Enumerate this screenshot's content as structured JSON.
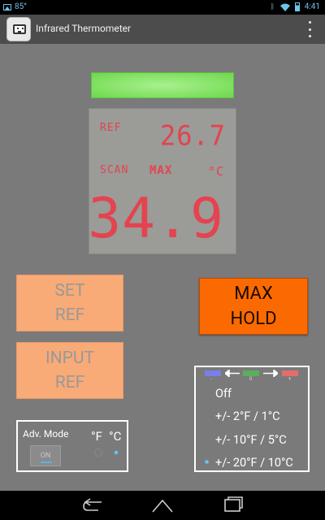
{
  "statusbar": {
    "notification_text": "85°",
    "time": "4:41"
  },
  "actionbar": {
    "title": "Infrared Thermometer",
    "icons": [
      "app-icon",
      "overflow-menu-icon"
    ]
  },
  "colors": {
    "indicator": "#7fe060",
    "lcd_background": "#9b9b98",
    "lcd_digits": "#f06060",
    "set_button": "#f8aa77",
    "max_button": "#fb6a00",
    "accent": "#5ab4e0"
  },
  "display": {
    "ref_label": "REF",
    "ref_value": "26.7",
    "scan_label": "SCAN",
    "mode_label": "MAX",
    "unit_label": "°C",
    "reading": "34.9"
  },
  "buttons": {
    "set_ref": "SET\nREF",
    "input_ref": "INPUT\nREF",
    "max_hold": "MAX\nHOLD"
  },
  "adv_mode": {
    "label": "Adv. Mode",
    "toggle": "ON",
    "unit_f": "°F",
    "unit_c": "°C",
    "selected_unit": "°C"
  },
  "tolerance": {
    "legend": [
      {
        "symbol": "-",
        "color": "#7a7ee8"
      },
      {
        "symbol": "0",
        "color": "#58b058"
      },
      {
        "symbol": "+",
        "color": "#e46c6c"
      }
    ],
    "options": [
      "Off",
      "+/- 2°F / 1°C",
      "+/- 10°F / 5°C",
      "+/- 20°F / 10°C"
    ],
    "selected": "+/- 20°F / 10°C"
  },
  "navbar": {
    "icons": [
      "back-icon",
      "home-icon",
      "recent-apps-icon"
    ]
  }
}
